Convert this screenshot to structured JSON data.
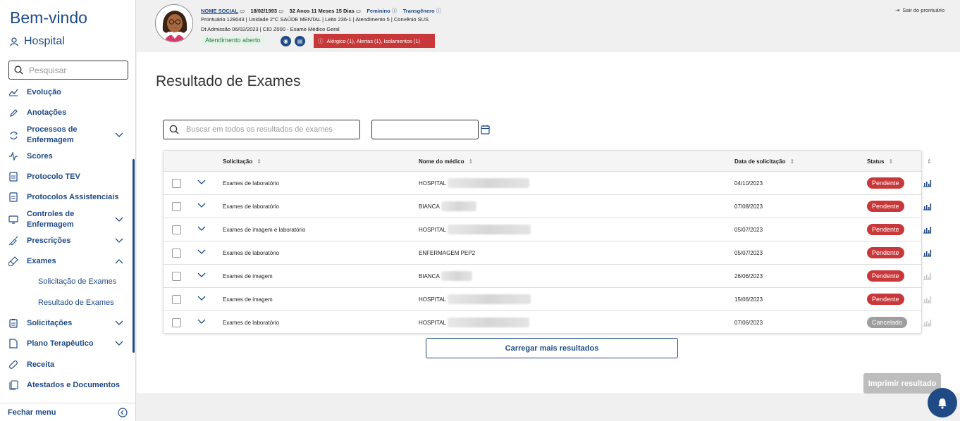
{
  "sidebar": {
    "welcome": "Bem-vindo",
    "hospital": "Hospital",
    "search_placeholder": "Pesquisar",
    "items": [
      {
        "label": "Evolução"
      },
      {
        "label": "Anotações"
      },
      {
        "label": "Processos de Enfermagem"
      },
      {
        "label": "Scores"
      },
      {
        "label": "Protocolo TEV"
      },
      {
        "label": "Protocolos Assistenciais"
      },
      {
        "label": "Controles de Enfermagem"
      },
      {
        "label": "Prescrições"
      },
      {
        "label": "Exames"
      },
      {
        "label": "Solicitações"
      },
      {
        "label": "Plano Terapêutico"
      },
      {
        "label": "Receita"
      },
      {
        "label": "Atestados e Documentos"
      }
    ],
    "subitems": [
      "Solicitação de Exames",
      "Resultado de Exames"
    ],
    "footer": "Fechar menu"
  },
  "patient": {
    "name": "NOME SOCIAL",
    "birth": "18/02/1993",
    "age": "32 Anos 11 Meses 15 Dias",
    "gender": "Feminino",
    "identity": "Transgênero",
    "line2": "Prontuário 128043  |  Unidade 2°C SAÚDE MENTAL  |  Leito 236-1  |  Atendimento 5  |  Convênio SUS",
    "line3": "Dt Admissão 06/02/2023  |  CID Z000 - Exame Médico Geral",
    "status": "Atendimento aberto",
    "alerts": "Alérgico (1),  Alertas (1),  Isolamentos (1)",
    "logout": "Sair do prontuário"
  },
  "main": {
    "title": "Resultado de Exames",
    "search_placeholder": "Buscar em todos os resultados de exames",
    "columns": {
      "solicitation": "Solicitação",
      "doctor": "Nome do médico",
      "date": "Data de solicitação",
      "status": "Status"
    },
    "rows": [
      {
        "type": "Exames de laboratório",
        "doctor": "HOSPITAL",
        "date": "04/10/2023",
        "status": "Pendente"
      },
      {
        "type": "Exames de laboratório",
        "doctor": "BIANCA",
        "date": "07/08/2023",
        "status": "Pendente"
      },
      {
        "type": "Exames de imagem e laboratório",
        "doctor": "HOSPITAL",
        "date": "05/07/2023",
        "status": "Pendente"
      },
      {
        "type": "Exames de laboratório",
        "doctor": "ENFERMAGEM PEP2",
        "date": "05/07/2023",
        "status": "Pendente"
      },
      {
        "type": "Exames de imagem",
        "doctor": "BIANCA",
        "date": "26/06/2023",
        "status": "Pendente"
      },
      {
        "type": "Exames de imagem",
        "doctor": "HOSPITAL",
        "date": "15/06/2023",
        "status": "Pendente"
      },
      {
        "type": "Exames de laboratório",
        "doctor": "HOSPITAL",
        "date": "07/06/2023",
        "status": "Cancelado"
      }
    ],
    "load_more": "Carregar mais resultados",
    "print": "Imprimir resultado"
  },
  "colors": {
    "brand": "#1f4a86",
    "pending": "#c8373a",
    "cancelled": "#9e9e9e"
  }
}
